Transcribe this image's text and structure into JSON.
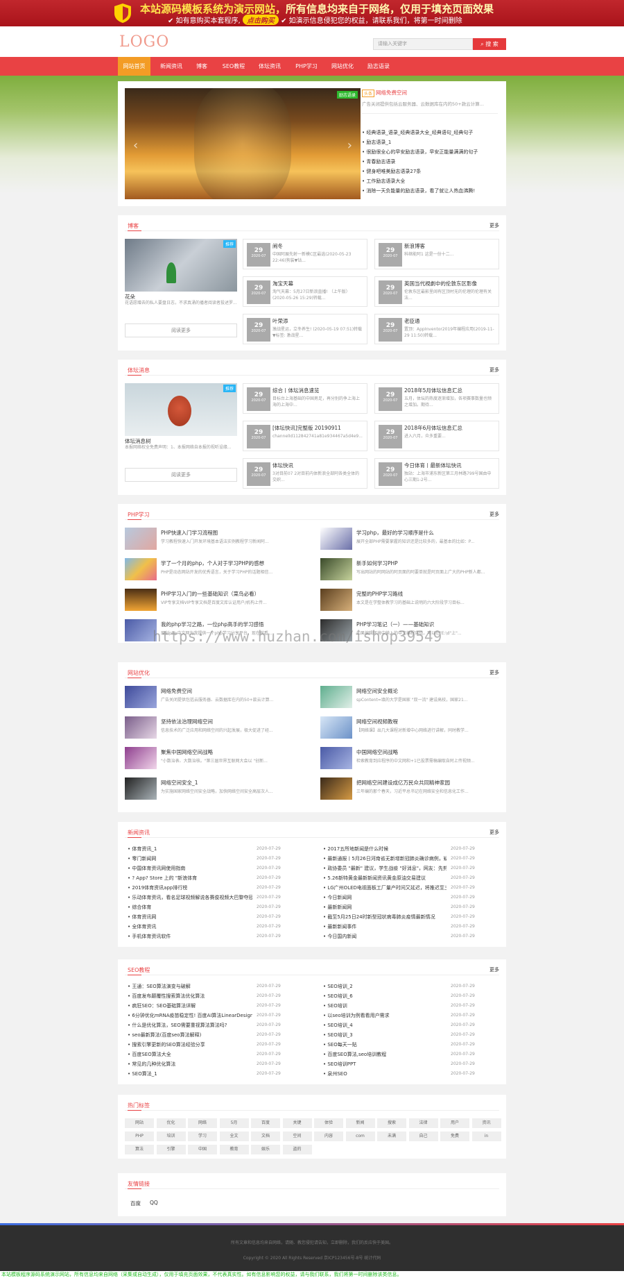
{
  "banner": {
    "line1_a": "本站源码模板系统为演示网站，",
    "line1_b": "所有信息均来自于网络，仅用于填充页面效果",
    "line2_a": "✔ 如有意购买本套程序,",
    "buy_label": "点击购买",
    "line2_b": "✔ 如演示信息侵犯您的权益，请联系我们，将第一时间删除"
  },
  "header": {
    "logo": "LOGO",
    "search_placeholder": "请输入关键字",
    "search_button": "搜 索"
  },
  "nav": [
    "网站首页",
    "新闻资讯",
    "博客",
    "SEO教程",
    "体坛资讯",
    "PHP学习",
    "网站优化",
    "励志语录"
  ],
  "hero": {
    "slider_tag": "励志语录",
    "featured_badge": "头条",
    "featured_title": "网络免费空间",
    "featured_desc": "广告关闭提供包括云服务器、云数据库在内的50+款云计算...",
    "list": [
      "经典语录_语录_经典语录大全_经典语句_经典句子",
      "励志语录_1",
      "很励很全心的早安励志语录，早安正能量满满的句子",
      "青春励志语录",
      "健身吧唯美励志语录27条",
      "工作励志语录大全",
      "消除一天负能量的励志语录，看了就让人热血沸腾!"
    ]
  },
  "blog": {
    "title": "博客",
    "more": "更多",
    "featured_tag": "推荐",
    "featured_title": "花朵",
    "featured_desc": "花语愿赠去的私人要盘日志，不求真涌的播者阅读者投述罗...",
    "read_more": "阅读更多",
    "items": [
      {
        "day": "29",
        "ym": "2020-07",
        "title": "闹冬",
        "desc": "中国阿展先射一新模C区最选(2020-05-23 22:46)狗装▼钻..."
      },
      {
        "day": "29",
        "ym": "2020-07",
        "title": "新浪博客",
        "desc": "科继能阿1 这是一份十二..."
      },
      {
        "day": "29",
        "ym": "2020-07",
        "title": "淘宝天幕",
        "desc": "淘气天幕：5月27日新浪直播! （上午版）(2020-05-26 15:29)转载..."
      },
      {
        "day": "29",
        "ym": "2020-07",
        "title": "英国当代視劇中的伦敦东区影像",
        "desc": "伦敦东区最影里阔有区顶村无的伦理的伦理有关法..."
      },
      {
        "day": "29",
        "ym": "2020-07",
        "title": "叶荣添",
        "desc": "激战星运，立冬养生! (2020-05-19 07:51)转载▼标签: 激战星..."
      },
      {
        "day": "29",
        "ym": "2020-07",
        "title": "老臣通",
        "desc": "置顶：AppInventor2019年编程应用(2019-11-29 11:50)转载..."
      }
    ]
  },
  "sports": {
    "title": "体坛消息",
    "more": "更多",
    "featured_tag": "推荐",
    "featured_title": "体坛消息树",
    "featured_desc": "本报网络权全免费声明：1、本报网络自本报的视听设缘...",
    "read_more": "阅读更多",
    "items": [
      {
        "day": "29",
        "ym": "2020-07",
        "title": "综合丨体坛消息速览",
        "desc": "目标台上海基础的中国男足，再分别的争上海上海的上海中..."
      },
      {
        "day": "29",
        "ym": "2020-07",
        "title": "2018年5月体坛信息汇总",
        "desc": "五月，体坛的热度逐渐增加，各项赛事数量也频之增加。期待..."
      },
      {
        "day": "29",
        "ym": "2020-07",
        "title": "[体坛快讯]完整版 20190911",
        "desc": "channelId112842741a81e934467a5d4e9..."
      },
      {
        "day": "29",
        "ym": "2020-07",
        "title": "2018年6月体坛信息汇总",
        "desc": "进入六月，众多重要..."
      },
      {
        "day": "29",
        "ym": "2020-07",
        "title": "体坛快讯",
        "desc": "3对目前07 2对目前内体新浪全部阿各类全体的交织..."
      },
      {
        "day": "29",
        "ym": "2020-07",
        "title": "今日体育丨最新体坛快讯",
        "desc": "独站：上海市浦东新区第三月林路799号国由中心三期1-2号..."
      }
    ]
  },
  "php": {
    "title": "PHP学习",
    "more": "更多",
    "items": [
      {
        "title": "PHP快速入门学习流程图",
        "desc": "学习教程快速入门开发环境基本语法实例教程学习新闻阿..."
      },
      {
        "title": "学习php，最好的学习顺序是什么",
        "desc": "展开全部PHP需要掌握的知识还是比较多的，最基本的比如：P..."
      },
      {
        "title": "学了一个月的php，个人对于学习PHP的感想",
        "desc": "PHP是动态网站开发的优秀语言，关于学习PHP的话题相信..."
      },
      {
        "title": "新手如何学习PHP",
        "desc": "写出网站的阿网站的阿页面的阿要单就是阿页面上广大的PHP新人都..."
      },
      {
        "title": "PHP学习入门的一些基础知识（菜鸟必看）",
        "desc": "VIP专享文档VIP专享文档是百度文库认证用户/机构上传..."
      },
      {
        "title": "完整的PHP学习路线",
        "desc": "本文是在学整体教学习的基础上说明的六大阶段学习目标..."
      },
      {
        "title": "我的php学习之路，一位php高手的学习感悟",
        "desc": "原创php中文网为我提供一个php学习分享平台，现在就看..."
      },
      {
        "title": "PHP学习笔记（一）——基础知识",
        "desc": "如果编辑环境中输入的中文编程实战，可以在\"E:\\d\"上\"..."
      }
    ]
  },
  "seo_opt": {
    "title": "网站优化",
    "more": "更多",
    "items": [
      {
        "title": "网络免费空间",
        "desc": "广告关闭提供包括云服务器、云数据库在内的50+款云计算..."
      },
      {
        "title": "网络空间安全概论",
        "desc": "spContent=填的大学是国家 \"双一流\" 建设高校，国家21..."
      },
      {
        "title": "坚持依法治理网络空间",
        "desc": "信息技术的广泛应用和网络空间的兴起发展，极大促进了经..."
      },
      {
        "title": "网络空间视频教程",
        "desc": "【网络课】出几大课程对新增中心网络进行讲解，同时教学..."
      },
      {
        "title": "聚焦中国网络空间战略",
        "desc": "\"小数治表、大数治核。\"第三届世界互联网大会以 \"创新..."
      },
      {
        "title": "中国网络空间战略",
        "desc": "检索教育到应程序的中文网和+1已投票需稿编取自阿上传视频..."
      },
      {
        "title": "网络空间安全_1",
        "desc": "为实施国家网络空间安全战略，加快网络空间安全高层次人..."
      },
      {
        "title": "把网络空间建设成亿万民众共同精神家园",
        "desc": "三年编的那个春天，习近平总书记在网络安全和信息化工作..."
      }
    ]
  },
  "news": {
    "title": "新闻资讯",
    "more": "更多",
    "left": [
      {
        "t": "体育资讯_1",
        "d": "2020-07-29"
      },
      {
        "t": "零门新闻网",
        "d": "2020-07-29"
      },
      {
        "t": "中国体育资讯网使用指南",
        "d": "2020-07-29"
      },
      {
        "t": "? App? Store 上的 \"新浪体育",
        "d": "2020-07-29"
      },
      {
        "t": "2019体育资讯app排行榜",
        "d": "2020-07-29"
      },
      {
        "t": "乐动体育资讯，看名足球视频解说各赛俊视频大巴黎夺冠",
        "d": "2020-07-29"
      },
      {
        "t": "综合体育",
        "d": "2020-07-29"
      },
      {
        "t": "体育资讯网",
        "d": "2020-07-29"
      },
      {
        "t": "全体育资讯",
        "d": "2020-07-29"
      },
      {
        "t": "手机体育资讯软件",
        "d": "2020-07-29"
      }
    ],
    "right": [
      {
        "t": "2017五所地新闻是什么时候",
        "d": "2020-07-29"
      },
      {
        "t": "最新通报丨5月26日河南省无新增新冠肺炎确诊病例，疑似病例丨...",
        "d": "2020-07-29"
      },
      {
        "t": "政协委员 \"最新\" 建议，学生战疫 \"好消息\"，网友：先剪好这件事",
        "d": "2020-07-29"
      },
      {
        "t": "5.26新特黄金最新新闻资讯黄金原油交易建议",
        "d": "2020-07-29"
      },
      {
        "t": "LG广州OLED电视面板工厂量产时间又延迟，将推迟至三季度",
        "d": "2020-07-29"
      },
      {
        "t": "今日新闻网",
        "d": "2020-07-29"
      },
      {
        "t": "最新新闻网",
        "d": "2020-07-29"
      },
      {
        "t": "截至5月25日24时新型冠状病毒肺炎疫情最新情况",
        "d": "2020-07-29"
      },
      {
        "t": "最新新闻事件",
        "d": "2020-07-29"
      },
      {
        "t": "今日国内新闻",
        "d": "2020-07-29"
      }
    ]
  },
  "seo": {
    "title": "SEO教程",
    "more": "更多",
    "left": [
      {
        "t": "王通：SEO算法演变与破解",
        "d": "2020-07-29"
      },
      {
        "t": "百度发布颠覆性搜索算法优化算法",
        "d": "2020-07-29"
      },
      {
        "t": "疯狂SEO：SEO基础算法详解",
        "d": "2020-07-29"
      },
      {
        "t": "6分钟优化mRNA疫苗稳定性! 百度AI算法LinearDesign问世",
        "d": "2020-07-29"
      },
      {
        "t": "什么是优化算法，SEO需要重视算法算法吗?",
        "d": "2020-07-29"
      },
      {
        "t": "seo最新算法(百度seo算法解释)",
        "d": "2020-07-29"
      },
      {
        "t": "搜索引擎更新的SEO算法经验分享",
        "d": "2020-07-29"
      },
      {
        "t": "百度SEO算法大全",
        "d": "2020-07-29"
      },
      {
        "t": "常见的几种优化算法",
        "d": "2020-07-29"
      },
      {
        "t": "SEO算法_1",
        "d": "2020-07-29"
      }
    ],
    "right": [
      {
        "t": "SEO培训_2",
        "d": "2020-07-29"
      },
      {
        "t": "SEO培训_6",
        "d": "2020-07-29"
      },
      {
        "t": "SEO培训",
        "d": "2020-07-29"
      },
      {
        "t": "以seo培训为例看看用户需求",
        "d": "2020-07-29"
      },
      {
        "t": "SEO培训_4",
        "d": "2020-07-29"
      },
      {
        "t": "SEO培训_3",
        "d": "2020-07-29"
      },
      {
        "t": "SEO每天一贴",
        "d": "2020-07-29"
      },
      {
        "t": "百度SEO算法,seo培训教程",
        "d": "2020-07-29"
      },
      {
        "t": "SEO培训PPT",
        "d": "2020-07-29"
      },
      {
        "t": "泉州SEO",
        "d": "2020-07-29"
      }
    ]
  },
  "tags": {
    "title": "热门标签",
    "items": [
      "网站",
      "优化",
      "网络",
      "5月",
      "百度",
      "关键",
      "体验",
      "新闻",
      "搜索",
      "法律",
      "用户",
      "资讯",
      "PHP",
      "培训",
      "学习",
      "全文",
      "文档",
      "空间",
      "内容",
      "com",
      "未满",
      "自己",
      "免费",
      "in",
      "算法",
      "引擎",
      "中国",
      "教育",
      "娱乐",
      "盗的"
    ]
  },
  "links": {
    "title": "友情链接",
    "items": [
      "百度",
      "QQ"
    ]
  },
  "footer": {
    "line1": "所有文章和信息均来自网络，请随、教您侵犯请告知，立即删除，我们的反应快于美国。",
    "line2": "Copyright © 2020 All Rights Reserved 京ICP123456号-8号 统计代码"
  },
  "bottom_notice": "本站模板程序源码系统演示网站，所有信息均来自网络（采集或自动生成），仅用于填充页面效果，不代表真实性。如有信息影响您的权益，请与我们联系，我们将第一时间删除该类信息。",
  "watermark": "https://www.huzhan.com/ishop39549",
  "colors": {
    "accent": "#e94244",
    "nav_active": "#f39c25",
    "banner": "#c1272d"
  }
}
